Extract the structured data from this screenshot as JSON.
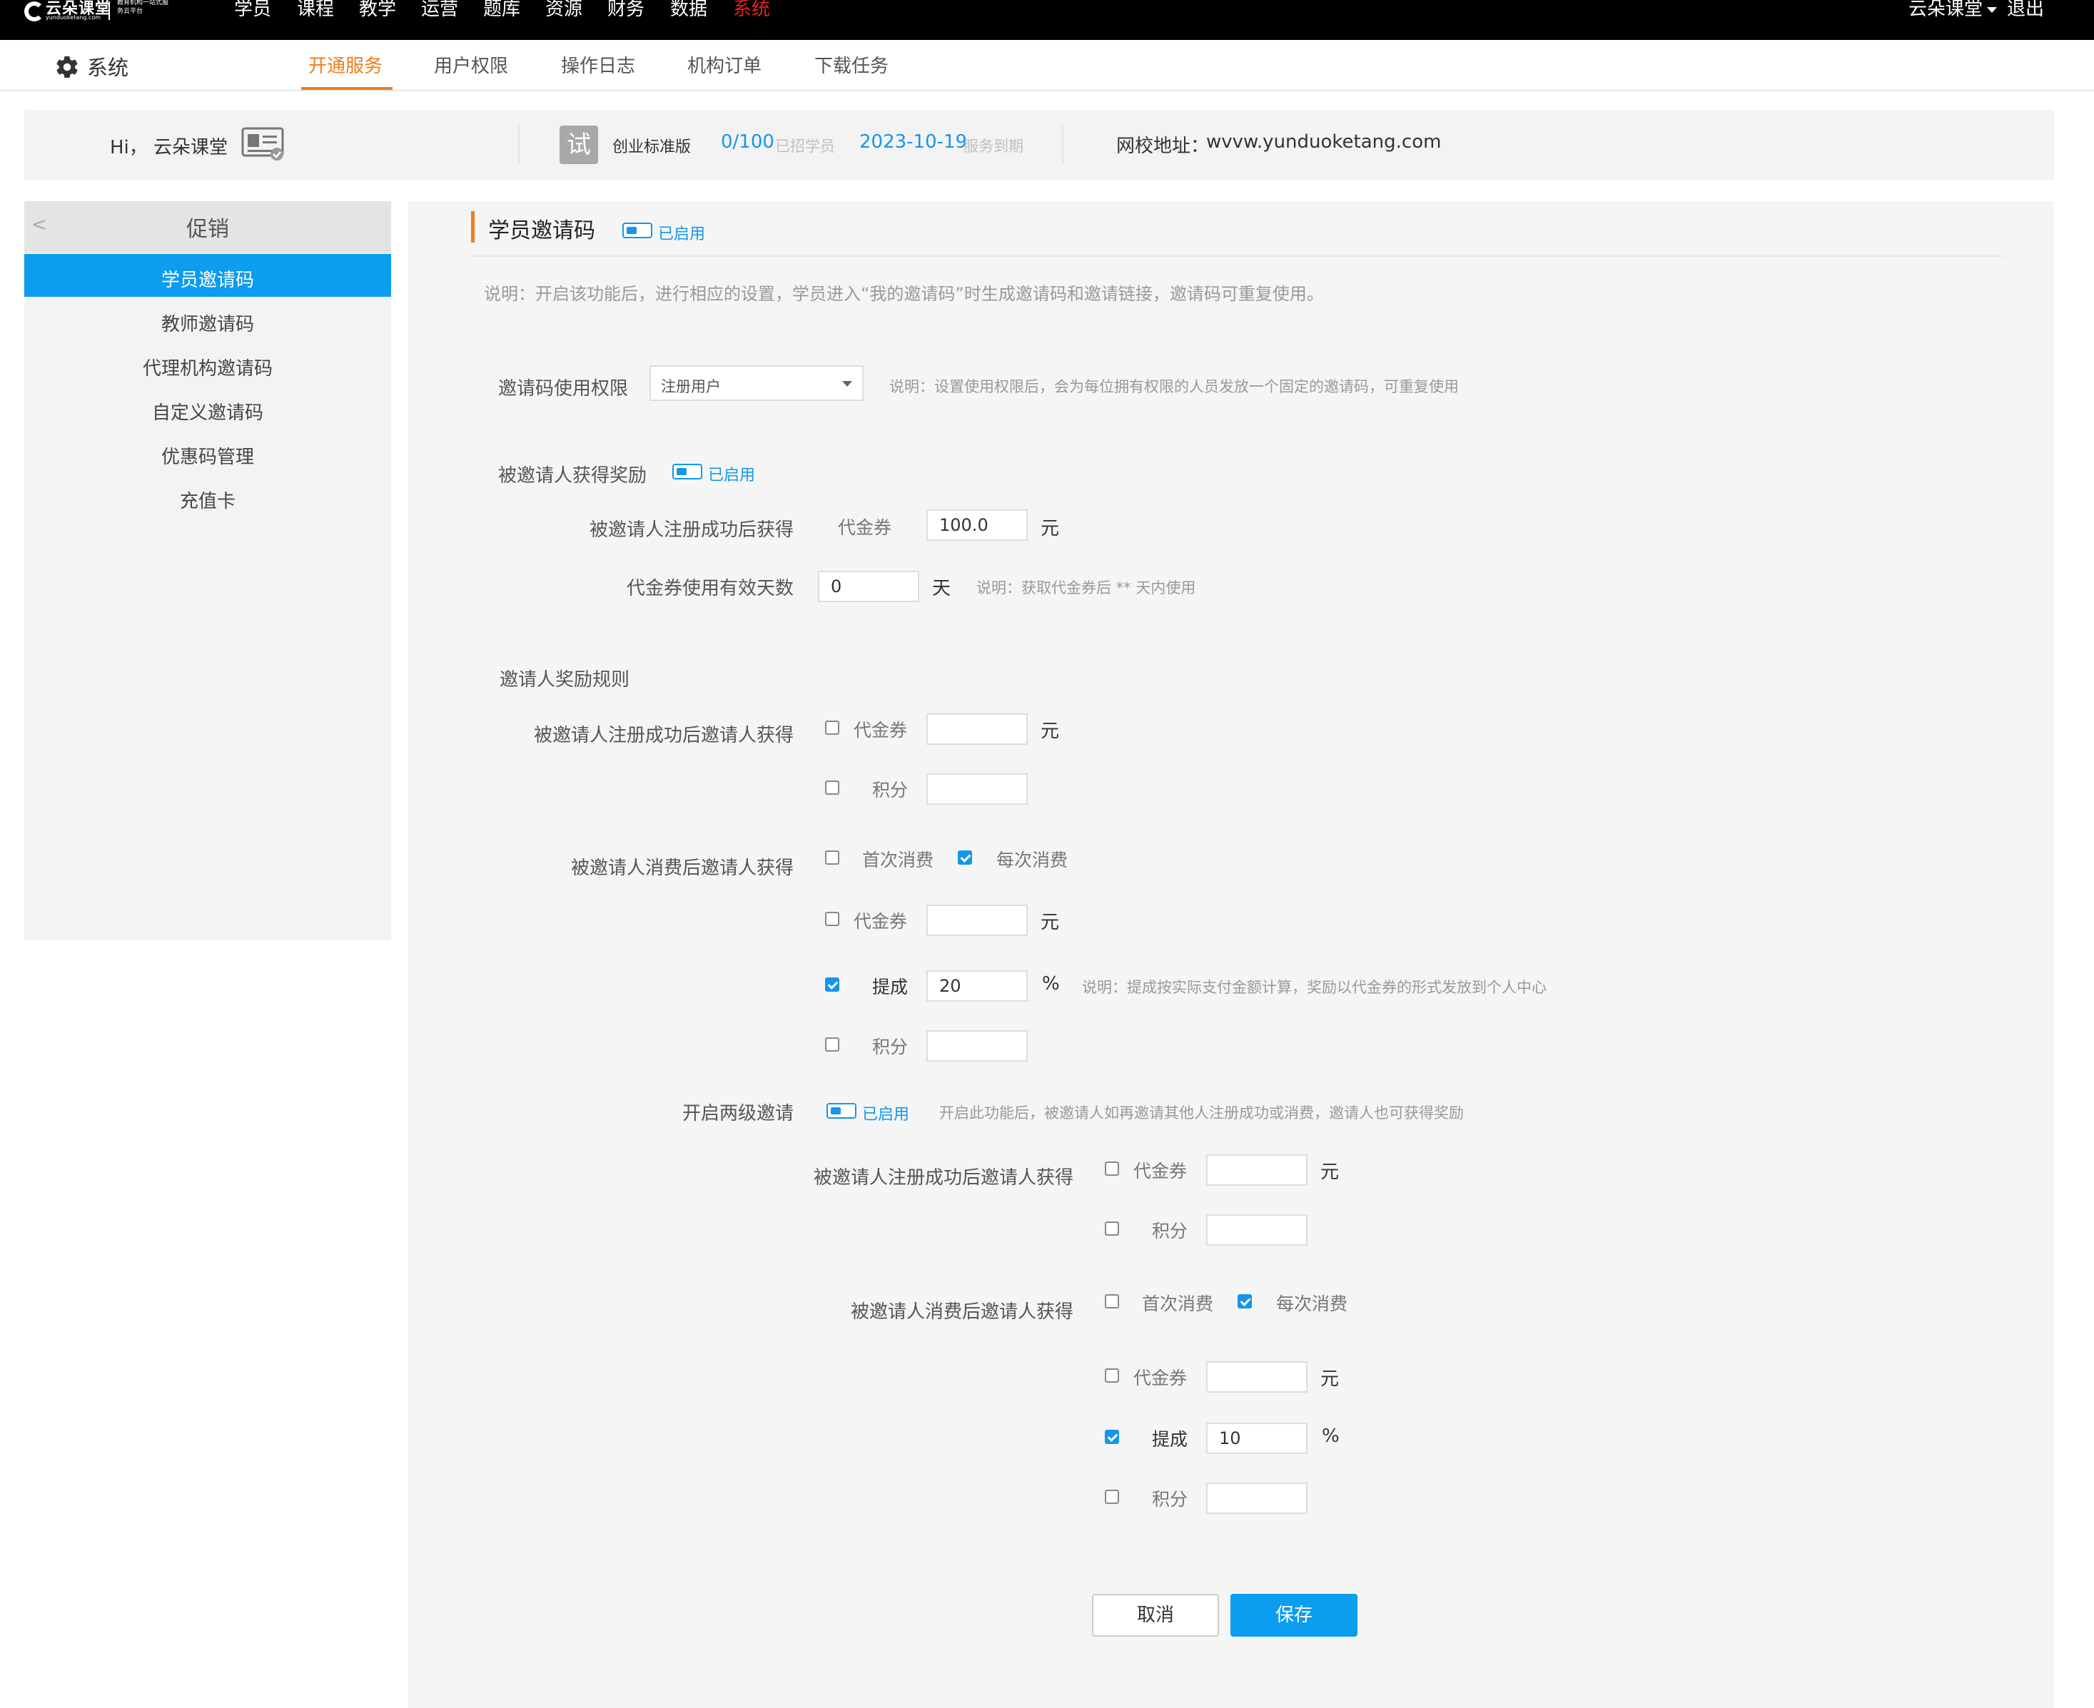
{
  "brand": {
    "name": "云朵课堂",
    "domain": "yunduoketang.com",
    "slogan": "教育机构一站式服务云平台"
  },
  "top_nav": [
    "学员",
    "课程",
    "教学",
    "运营",
    "题库",
    "资源",
    "财务",
    "数据",
    "系统"
  ],
  "top_nav_active": "系统",
  "user_menu": {
    "name": "云朵课堂",
    "logout": "退出"
  },
  "sub_nav": {
    "title": "系统",
    "tabs": [
      "开通服务",
      "用户权限",
      "操作日志",
      "机构订单",
      "下载任务"
    ],
    "active_tab": "开通服务"
  },
  "info": {
    "greeting": "Hi， 云朵课堂",
    "trial_badge": "试",
    "edition": "创业标准版",
    "students_count": "0/100",
    "students_label": "已招学员",
    "expire_date": "2023-10-19",
    "expire_label": "服务到期",
    "school_url_label": "网校地址：",
    "school_url": "wvvw.yunduoketang.com"
  },
  "sidebar": {
    "header": "促销",
    "items": [
      "学员邀请码",
      "教师邀请码",
      "代理机构邀请码",
      "自定义邀请码",
      "优惠码管理",
      "充值卡"
    ],
    "active": "学员邀请码"
  },
  "main": {
    "title": "学员邀请码",
    "status": "已启用",
    "description": "说明：开启该功能后，进行相应的设置，学员进入“我的邀请码”时生成邀请码和邀请链接，邀请码可重复使用。",
    "permission": {
      "label": "邀请码使用权限",
      "value": "注册用户",
      "note": "说明：设置使用权限后，会为每位拥有权限的人员发放一个固定的邀请码，可重复使用"
    },
    "invitee_reward": {
      "label": "被邀请人获得奖励",
      "status": "已启用",
      "register_label": "被邀请人注册成功后获得",
      "coupon_label": "代金券",
      "coupon_value": "100.0",
      "coupon_unit": "元",
      "valid_days_label": "代金券使用有效天数",
      "valid_days_value": "0",
      "valid_days_unit": "天",
      "valid_days_note": "说明：获取代金券后 ** 天内使用"
    },
    "inviter_rules": {
      "label": "邀请人奖励规则",
      "register_label": "被邀请人注册成功后邀请人获得",
      "coupon_label": "代金券",
      "coupon_unit": "元",
      "points_label": "积分",
      "consume_label": "被邀请人消费后邀请人获得",
      "first_consume": "首次消费",
      "every_consume": "每次消费",
      "commission_label": "提成",
      "commission_value": "20",
      "commission_unit": "%",
      "commission_note": "说明：提成按实际支付金额计算，奖励以代金券的形式发放到个人中心"
    },
    "two_level": {
      "label": "开启两级邀请",
      "status": "已启用",
      "note": "开启此功能后，被邀请人如再邀请其他人注册成功或消费，邀请人也可获得奖励",
      "register_label": "被邀请人注册成功后邀请人获得",
      "coupon_label": "代金券",
      "coupon_unit": "元",
      "points_label": "积分",
      "consume_label": "被邀请人消费后邀请人获得",
      "first_consume": "首次消费",
      "every_consume": "每次消费",
      "commission_label": "提成",
      "commission_value": "10",
      "commission_unit": "%"
    }
  },
  "buttons": {
    "cancel": "取消",
    "save": "保存"
  },
  "colors": {
    "accent": "#0c9cf0",
    "active_tab": "#f07d1c",
    "top_active": "#e02020"
  }
}
